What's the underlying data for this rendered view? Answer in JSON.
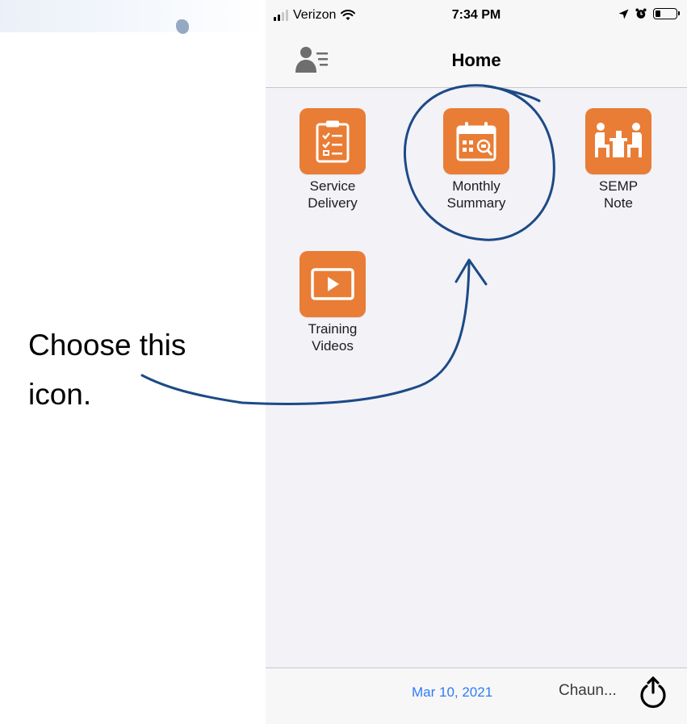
{
  "status_bar": {
    "carrier": "Verizon",
    "time": "7:34 PM",
    "battery_level": 0.25
  },
  "nav": {
    "title": "Home"
  },
  "grid": {
    "items": [
      {
        "label": "Service\nDelivery",
        "icon": "clipboard-checklist-icon"
      },
      {
        "label": "Monthly\nSummary",
        "icon": "calendar-search-icon"
      },
      {
        "label": "SEMP\nNote",
        "icon": "meeting-desk-icon"
      },
      {
        "label": "Training\nVideos",
        "icon": "play-video-icon"
      }
    ]
  },
  "bottom_bar": {
    "date": "Mar 10, 2021",
    "user": "Chaun..."
  },
  "annotation": {
    "text": "Choose this\nicon."
  },
  "colors": {
    "tile": "#e97d35",
    "link": "#2f7cf6",
    "pen": "#1c4a86"
  }
}
